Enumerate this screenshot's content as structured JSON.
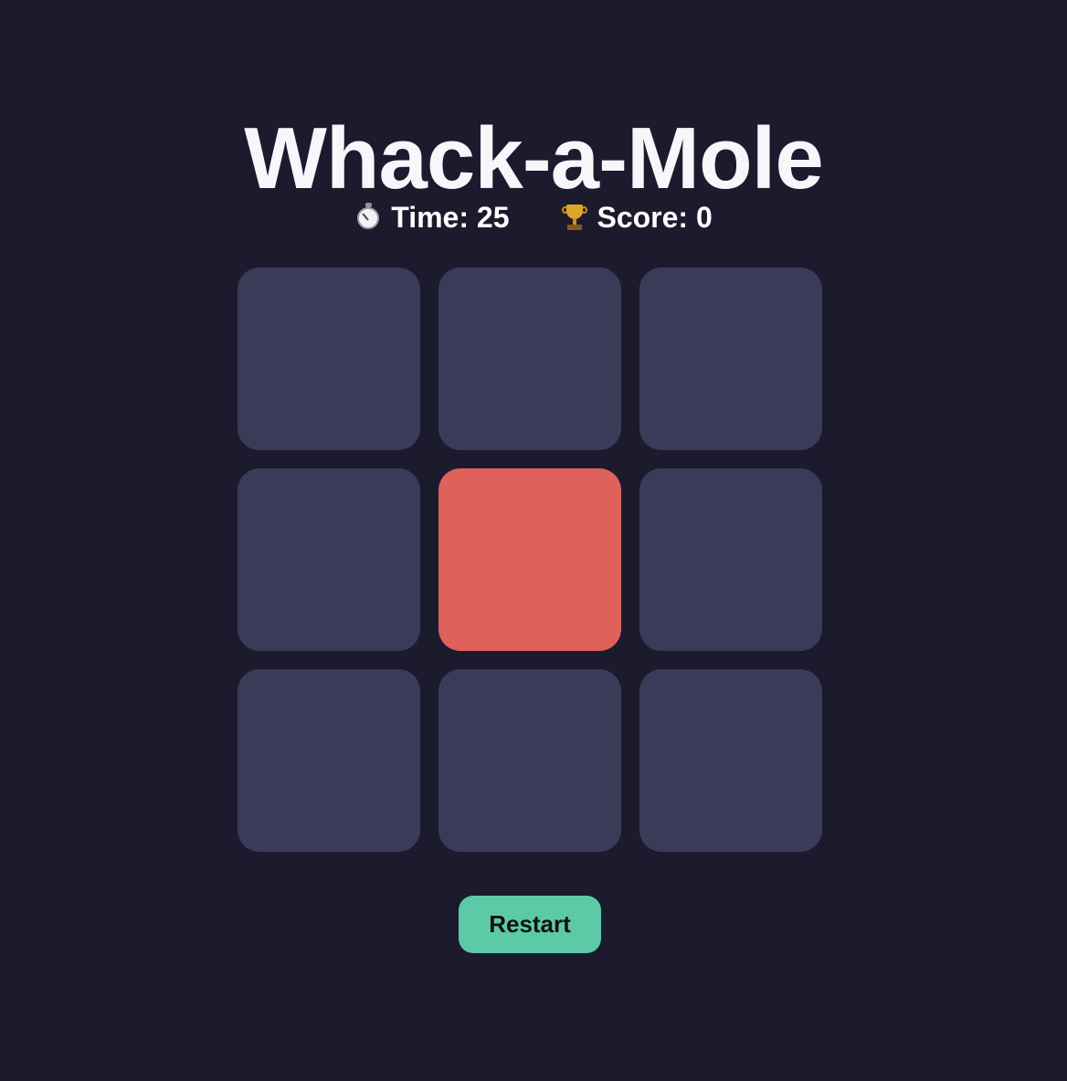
{
  "game": {
    "title": "Whack-a-Mole"
  },
  "stats": {
    "time": {
      "icon": "stopwatch-icon",
      "text": "Time: 25",
      "value": 25
    },
    "score": {
      "icon": "trophy-icon",
      "text": "Score: 0",
      "value": 0
    }
  },
  "board": {
    "rows": 3,
    "cols": 3,
    "active_hole_index": 4,
    "colors": {
      "hole": "#3b3a59",
      "active_hole": "#df615b"
    }
  },
  "controls": {
    "restart_label": "Restart",
    "restart_color": "#5cc9a7"
  },
  "theme": {
    "background": "#1b1b2d",
    "text": "#f6f7fb"
  }
}
